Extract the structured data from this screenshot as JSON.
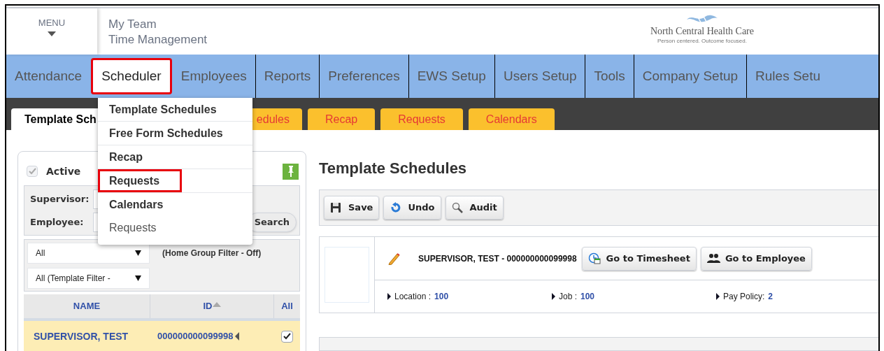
{
  "menu_button": {
    "label": "MENU"
  },
  "app_title": [
    "My Team",
    "Time Management"
  ],
  "logo": {
    "name": "North Central Health Care",
    "tagline": "Person centered. Outcome focused."
  },
  "nav": [
    {
      "label": "Attendance",
      "selected": false,
      "highlighted": false
    },
    {
      "label": "Scheduler",
      "selected": true,
      "highlighted": true
    },
    {
      "label": "Employees",
      "selected": false,
      "highlighted": false
    },
    {
      "label": "Reports",
      "selected": false,
      "highlighted": false
    },
    {
      "label": "Preferences",
      "selected": false,
      "highlighted": false
    },
    {
      "label": "EWS Setup",
      "selected": false,
      "highlighted": false
    },
    {
      "label": "Users Setup",
      "selected": false,
      "highlighted": false
    },
    {
      "label": "Tools",
      "selected": false,
      "highlighted": false
    },
    {
      "label": "Company Setup",
      "selected": false,
      "highlighted": false
    },
    {
      "label": "Rules Setu",
      "selected": false,
      "highlighted": false
    }
  ],
  "sub_tabs": [
    {
      "label": "Template Sch",
      "selected": true
    },
    {
      "label": "edules",
      "selected": false
    },
    {
      "label": "Recap",
      "selected": false
    },
    {
      "label": "Requests",
      "selected": false
    },
    {
      "label": "Calendars",
      "selected": false
    }
  ],
  "dropdown": {
    "items": [
      {
        "label": "Template Schedules",
        "kind": "bold",
        "highlighted": false
      },
      {
        "label": "Free Form Schedules",
        "kind": "bold",
        "highlighted": false
      },
      {
        "label": "Recap",
        "kind": "bold",
        "highlighted": false
      },
      {
        "label": "Requests",
        "kind": "bold",
        "highlighted": true
      },
      {
        "label": "Calendars",
        "kind": "bold",
        "highlighted": false
      },
      {
        "label": "Requests",
        "kind": "plain",
        "highlighted": false
      }
    ]
  },
  "filter_panel": {
    "active": {
      "label": "Active",
      "checked": true,
      "disabled": true
    },
    "supervisor_label": "Supervisor:",
    "employee_label": "Employee:",
    "search_button": "Search",
    "group_select": "All",
    "home_group_filter": "(Home Group Filter - Off)",
    "template_select": "All (Template Filter -"
  },
  "employee_table": {
    "columns": [
      {
        "label": "NAME",
        "sorted": false
      },
      {
        "label": "ID",
        "sorted": true
      },
      {
        "label": "All",
        "sorted": false
      }
    ],
    "rows": [
      {
        "name": "SUPERVISOR, TEST",
        "id": "000000000099998",
        "checked": true,
        "selected": true
      }
    ]
  },
  "page_title": "Template Schedules",
  "toolbar": [
    {
      "label": "Save",
      "kind": "save"
    },
    {
      "label": "Undo",
      "kind": "undo"
    },
    {
      "label": "Audit",
      "kind": "audit"
    }
  ],
  "employee_card": {
    "title": "SUPERVISOR, TEST - 000000000099998",
    "buttons": [
      {
        "label": "Go to Timesheet",
        "kind": "timesheet"
      },
      {
        "label": "Go to Employee",
        "kind": "employee"
      }
    ],
    "fields": [
      {
        "label": "Location :",
        "value": "100"
      },
      {
        "label": "Job :",
        "value": "100"
      },
      {
        "label": "Pay Policy:",
        "value": "2"
      }
    ]
  }
}
